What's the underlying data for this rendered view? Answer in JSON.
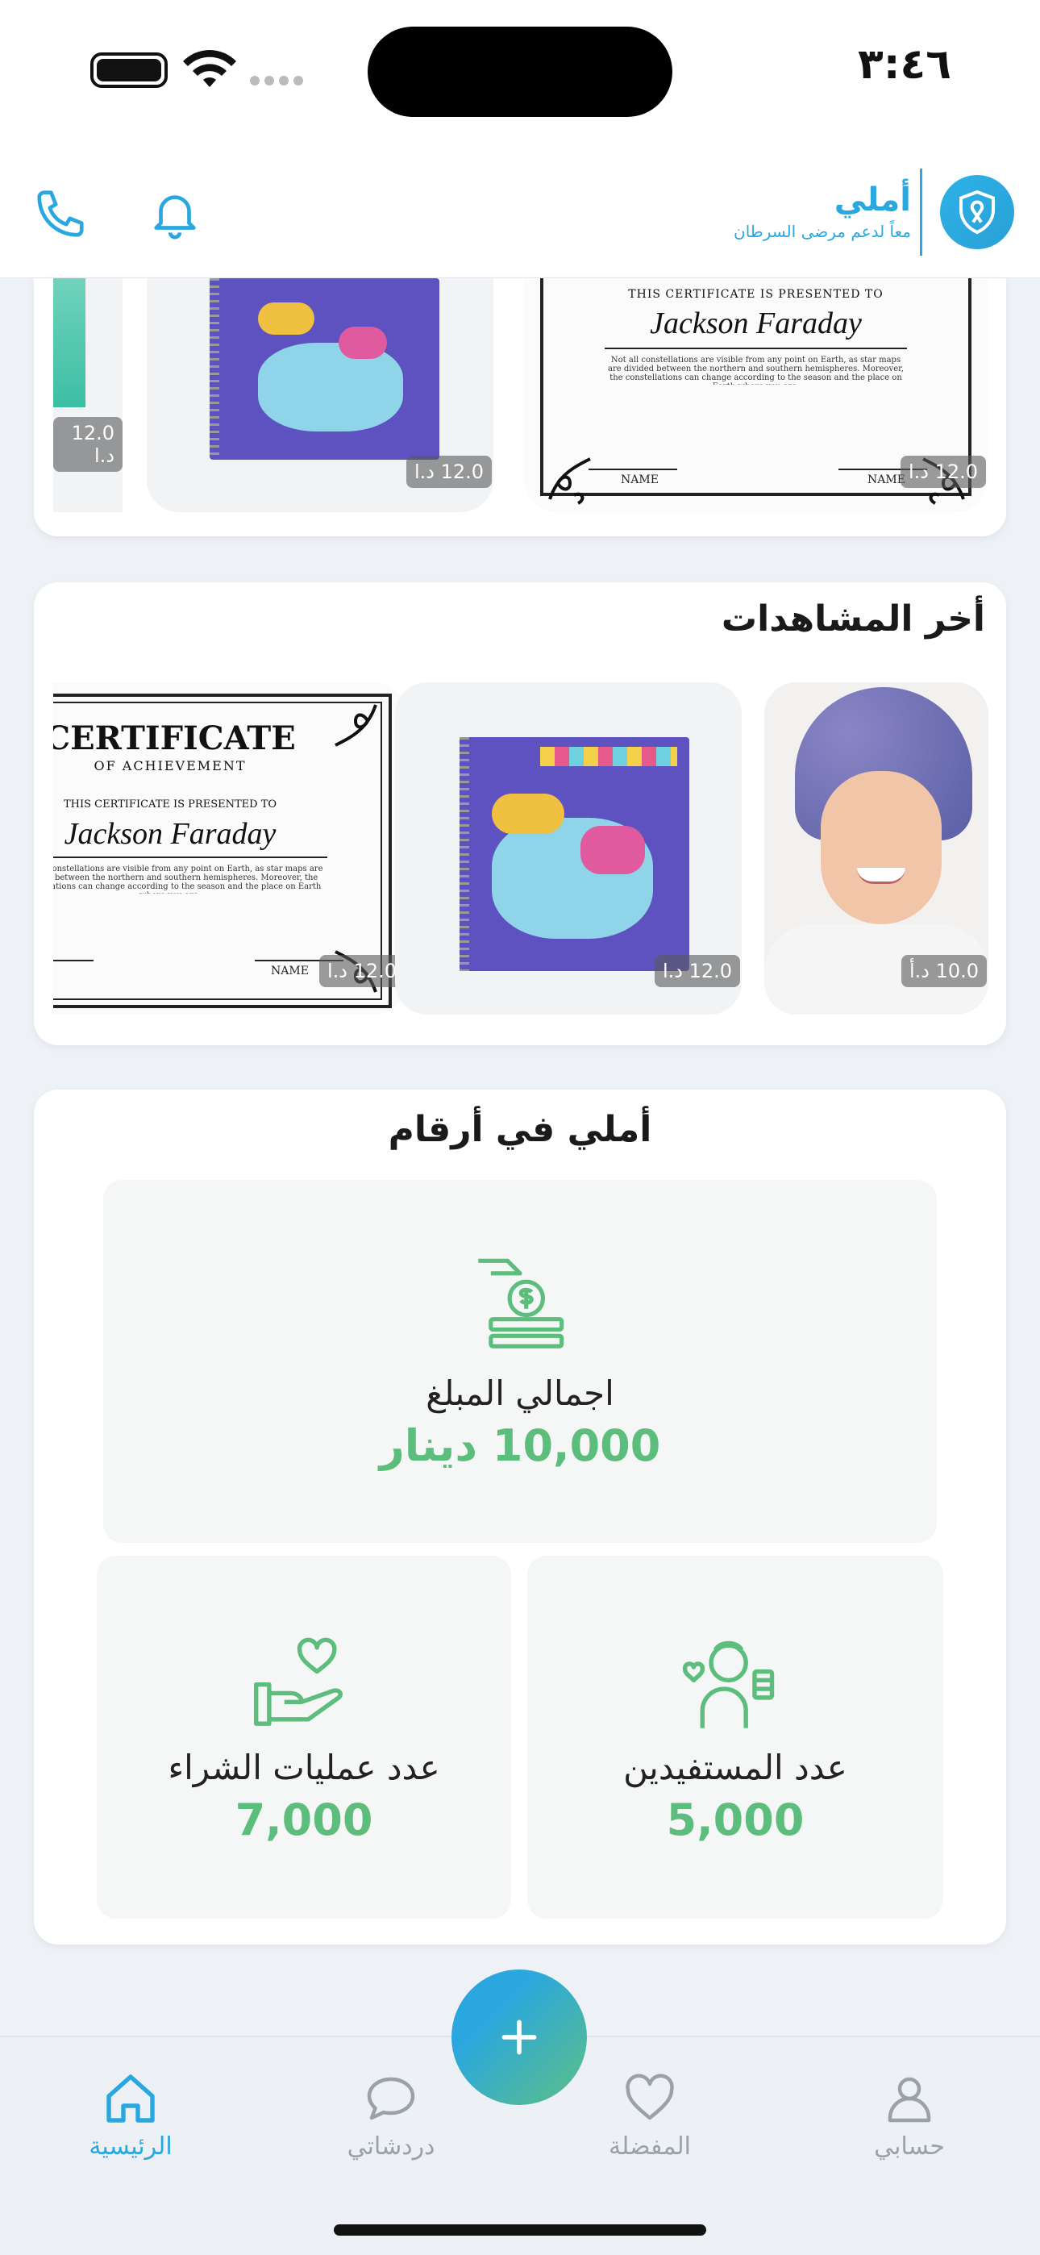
{
  "status_bar": {
    "time": "٣:٤٦"
  },
  "header": {
    "brand_name": "أملي",
    "brand_tagline": "معاً لدعم مرضى السرطان"
  },
  "top_products": {
    "items": [
      {
        "price": "12.0 د.ا"
      },
      {
        "price": "12.0 د.ا"
      },
      {
        "price": "12.0 د.ا"
      }
    ]
  },
  "certificate": {
    "presented": "THIS CERTIFICATE IS PRESENTED TO",
    "name": "Jackson Faraday",
    "text": "Not all constellations are visible from any point on Earth, as star maps are divided between the northern and southern hemispheres. Moreover, the constellations can change according to the season and the place on Earth where you are.",
    "name_label": "NAME",
    "title": "CERTIFICATE",
    "subtitle": "OF ACHIEVEMENT"
  },
  "recent": {
    "title": "أخر المشاهدات",
    "items": [
      {
        "price": "10.0 د.أ"
      },
      {
        "price": "12.0 د.ا"
      },
      {
        "price": "12.0 د.ا"
      }
    ]
  },
  "stats": {
    "title": "أملي في أرقام",
    "total_label": "اجمالي المبلغ",
    "total_value": "10,000 دينار",
    "purchases_label": "عدد عمليات الشراء",
    "purchases_value": "7,000",
    "beneficiaries_label": "عدد المستفيدين",
    "beneficiaries_value": "5,000"
  },
  "nav": {
    "home": "الرئيسية",
    "chats": "دردشاتي",
    "favorites": "المفضلة",
    "account": "حسابي"
  },
  "colors": {
    "brand": "#2aa7df",
    "stat_green": "#5cbd7c"
  }
}
